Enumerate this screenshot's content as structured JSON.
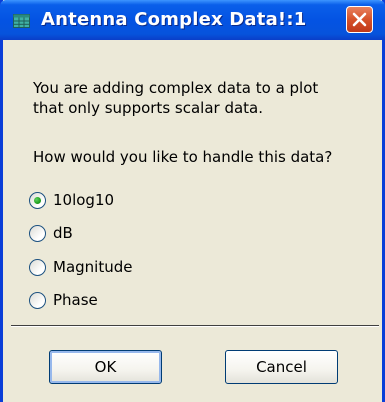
{
  "window": {
    "title": "Antenna Complex Data!:1"
  },
  "message": {
    "line1": "You are adding complex data to a plot",
    "line2": "that only supports scalar data."
  },
  "prompt": "How would you like to handle this data?",
  "options": [
    {
      "label": "10log10",
      "selected": true
    },
    {
      "label": "dB",
      "selected": false
    },
    {
      "label": "Magnitude",
      "selected": false
    },
    {
      "label": "Phase",
      "selected": false
    }
  ],
  "buttons": {
    "ok": "OK",
    "cancel": "Cancel"
  },
  "icons": {
    "app": "grid-window-icon",
    "close": "close-icon"
  },
  "colors": {
    "titlebar": "#0453e3",
    "frame": "#0a3ed8",
    "close_button": "#d6522a",
    "dialog_bg": "#ece9d8",
    "radio_selected": "#21a121"
  }
}
